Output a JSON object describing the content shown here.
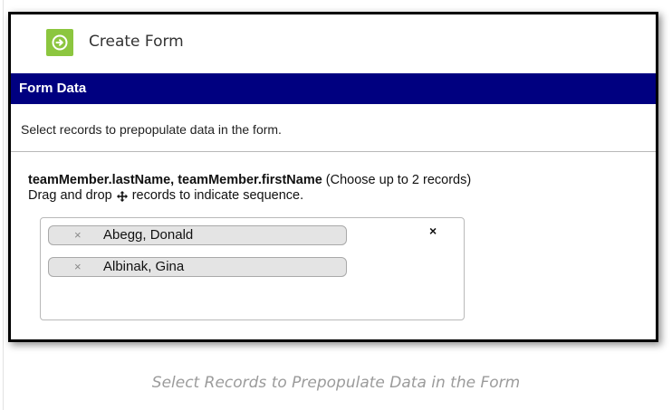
{
  "header": {
    "title": "Create Form",
    "icon": "arrow-circle-icon",
    "icon_color": "#8cc63f"
  },
  "section": {
    "title": "Form Data",
    "bar_color": "#000080"
  },
  "instruction": "Select records to prepopulate data in the form.",
  "field": {
    "label_bold": "teamMember.lastName, teamMember.firstName",
    "label_hint": " (Choose up to 2 records)",
    "drag_prefix": "Drag and drop",
    "drag_suffix": "records to indicate sequence."
  },
  "selection": {
    "clear_all": "×",
    "items": [
      {
        "remove": "×",
        "label": "Abegg, Donald"
      },
      {
        "remove": "×",
        "label": "Albinak, Gina"
      }
    ]
  },
  "caption": "Select Records to Prepopulate Data in the Form"
}
